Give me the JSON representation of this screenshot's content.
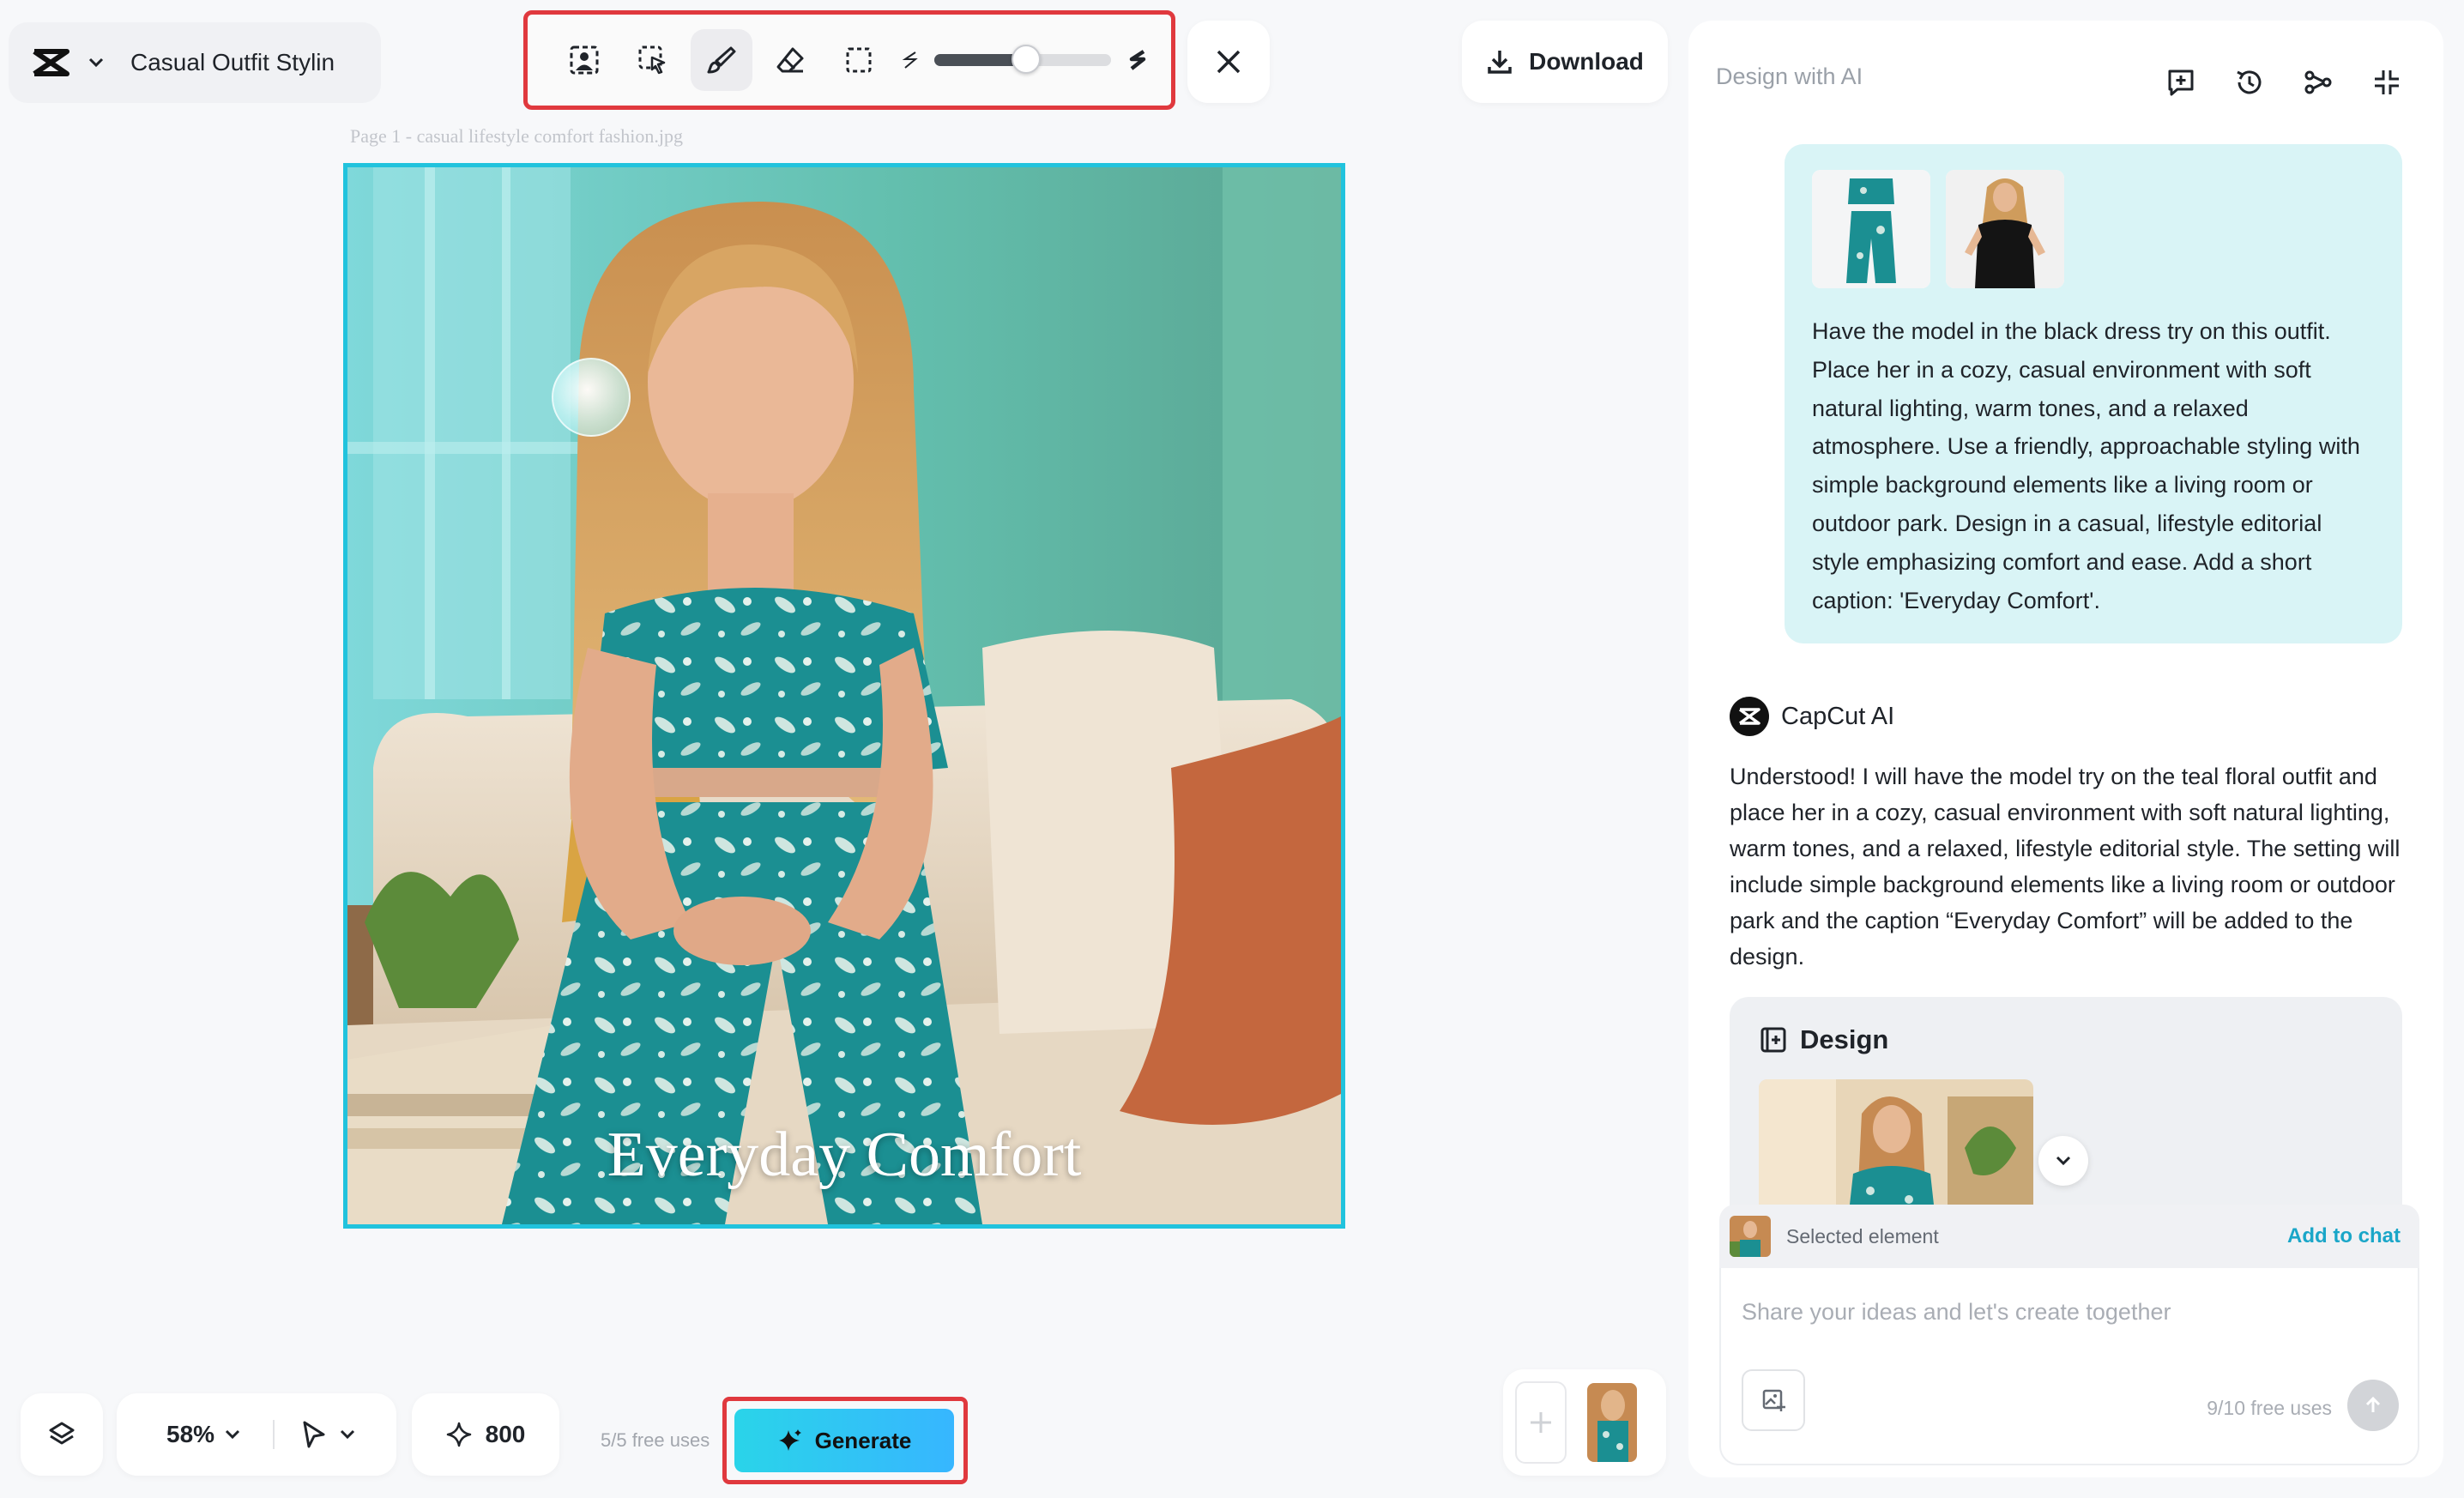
{
  "project": {
    "title": "Casual Outfit Stylin"
  },
  "toolbar": {
    "tools": [
      {
        "name": "subject-select-icon"
      },
      {
        "name": "pointer-select-icon"
      },
      {
        "name": "brush-icon",
        "active": true
      },
      {
        "name": "eraser-icon"
      },
      {
        "name": "rect-select-icon"
      }
    ],
    "brush_size_fraction": 0.52
  },
  "download": {
    "label": "Download"
  },
  "canvas": {
    "page_label": "Page 1 -  casual  lifestyle  comfort  fashion.jpg",
    "caption": "Everyday Comfort"
  },
  "bottom": {
    "zoom": "58%",
    "credits": "800",
    "free_uses": "5/5 free uses",
    "generate_label": "Generate"
  },
  "panel": {
    "title": "Design with AI",
    "user_message": "Have the model in the black dress try on this outfit. Place her in a cozy, casual environment with soft natural lighting, warm tones, and a relaxed atmosphere. Use a friendly, approachable styling with simple background elements like a living room or outdoor park. Design in a casual, lifestyle editorial style emphasizing comfort and ease. Add a short caption: 'Everyday Comfort'.",
    "ai_name": "CapCut AI",
    "ai_message": "Understood! I will have the model try on the teal floral outfit and place her in a cozy, casual environment with soft natural lighting, warm tones, and a relaxed, lifestyle editorial style. The setting will include simple background elements like a living room or outdoor park and the caption “Everyday Comfort” will be added to the design.",
    "design_label": "Design",
    "selected_label": "Selected element",
    "add_to_chat": "Add to chat",
    "input_placeholder": "Share your ideas and let's create together",
    "chat_uses": "9/10 free uses"
  },
  "colors": {
    "accent": "#21c3dd",
    "highlight": "#e0393e",
    "generate_start": "#2ad4e9",
    "generate_end": "#37b6ff",
    "user_bubble": "#d9f4f6"
  }
}
